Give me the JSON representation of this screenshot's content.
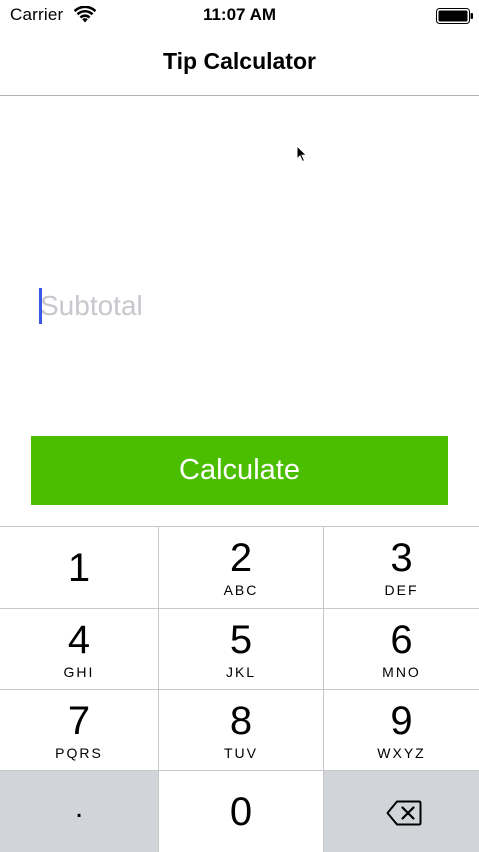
{
  "status_bar": {
    "carrier": "Carrier",
    "time": "11:07 AM",
    "wifi_icon": "wifi-icon",
    "battery_icon": "battery-icon"
  },
  "nav": {
    "title": "Tip Calculator"
  },
  "subtotal": {
    "placeholder": "Subtotal",
    "value": ""
  },
  "calculate_button": {
    "label": "Calculate"
  },
  "keypad": {
    "keys": [
      {
        "digit": "1",
        "letters": ""
      },
      {
        "digit": "2",
        "letters": "ABC"
      },
      {
        "digit": "3",
        "letters": "DEF"
      },
      {
        "digit": "4",
        "letters": "GHI"
      },
      {
        "digit": "5",
        "letters": "JKL"
      },
      {
        "digit": "6",
        "letters": "MNO"
      },
      {
        "digit": "7",
        "letters": "PQRS"
      },
      {
        "digit": "8",
        "letters": "TUV"
      },
      {
        "digit": "9",
        "letters": "WXYZ"
      }
    ],
    "decimal": ".",
    "zero": "0",
    "backspace_icon": "backspace-icon"
  },
  "colors": {
    "accent_button": "#4cbe00",
    "caret": "#3b58e6",
    "placeholder": "#c7c7cd",
    "dark_key": "#d1d4d9"
  }
}
